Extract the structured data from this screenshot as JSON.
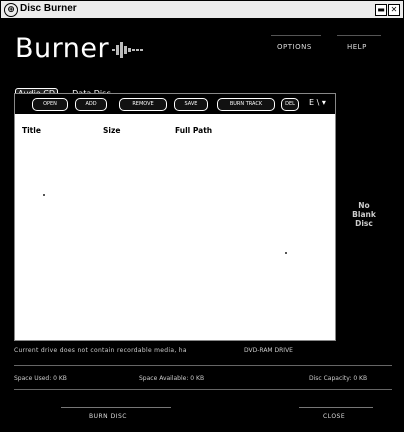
{
  "window": {
    "title": "Disc Burner",
    "min_symbol": "▬",
    "close_symbol": "✕"
  },
  "header": {
    "brand": "Burner",
    "menu_options": "OPTIONS",
    "menu_help": "HELP"
  },
  "tabs": [
    {
      "label": "Audio CD",
      "active": true
    },
    {
      "label": "Data Disc",
      "active": false
    }
  ],
  "toolbar": {
    "buttons": [
      "OPEN",
      "ADD",
      "REMOVE",
      "SAVE",
      "BURN TRACK",
      "DEL"
    ],
    "extra": "E \\"
  },
  "columns": {
    "title": "Title",
    "size": "Size",
    "full_path": "Full Path"
  },
  "side": {
    "line1": "No",
    "line2": "Blank",
    "line3": "Disc"
  },
  "status": {
    "message": "Current drive does not contain recordable media, ha",
    "drive": "DVD-RAM DRIVE"
  },
  "space": {
    "used": "Space Used: 0 KB",
    "available": "Space Available: 0 KB",
    "capacity": "Disc Capacity: 0 KB"
  },
  "footer": {
    "burn": "BURN DISC",
    "close": "CLOSE"
  }
}
